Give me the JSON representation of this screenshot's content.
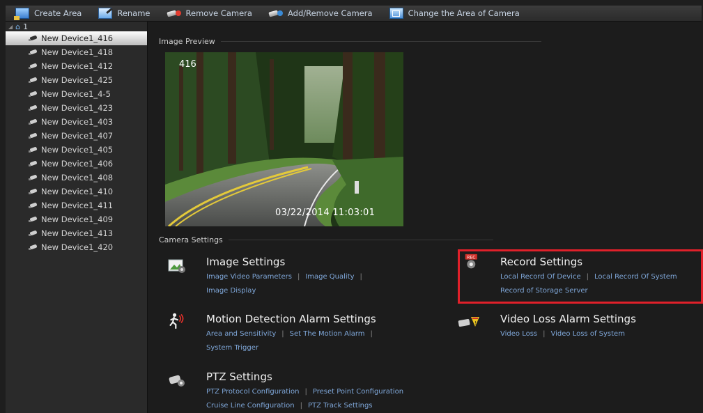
{
  "toolbar": {
    "create_area": "Create Area",
    "rename": "Rename",
    "remove_camera": "Remove Camera",
    "add_remove_camera": "Add/Remove Camera",
    "change_area": "Change the Area of Camera"
  },
  "sidebar": {
    "root_label": "1",
    "devices": [
      "New Device1_416",
      "New Device1_418",
      "New Device1_412",
      "New Device1_425",
      "New Device1_4-5",
      "New Device1_423",
      "New Device1_403",
      "New Device1_407",
      "New Device1_405",
      "New Device1_406",
      "New Device1_408",
      "New Device1_410",
      "New Device1_411",
      "New Device1_409",
      "New Device1_413",
      "New Device1_420"
    ],
    "selected_index": 0
  },
  "preview": {
    "section_label": "Image Preview",
    "camera_number": "416",
    "timestamp": "03/22/2014 11:03:01"
  },
  "camera_settings": {
    "section_label": "Camera Settings",
    "image": {
      "title": "Image Settings",
      "links": [
        "Image Video Parameters",
        "Image Quality",
        "Image Display"
      ]
    },
    "record": {
      "title": "Record Settings",
      "links": [
        "Local Record Of Device",
        "Local Record Of System",
        "Record of Storage Server"
      ]
    },
    "motion": {
      "title": "Motion Detection Alarm Settings",
      "links": [
        "Area and Sensitivity",
        "Set The Motion Alarm",
        "System Trigger"
      ]
    },
    "video_loss": {
      "title": "Video Loss Alarm Settings",
      "links": [
        "Video Loss",
        "Video Loss of System"
      ]
    },
    "ptz": {
      "title": "PTZ Settings",
      "links": [
        "PTZ Protocol Configuration",
        "Preset Point Configuration",
        "Cruise Line Configuration",
        "PTZ Track Settings"
      ]
    }
  },
  "colors": {
    "highlight": "#e0202a",
    "link": "#7fa7d9"
  }
}
